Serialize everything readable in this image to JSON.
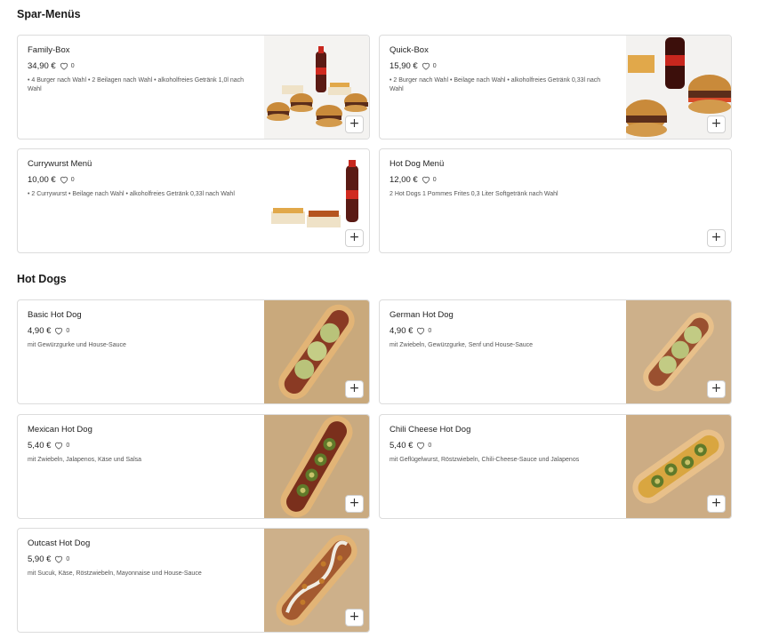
{
  "sections": [
    {
      "title": "Spar-Menüs",
      "items": [
        {
          "name": "Family-Box",
          "price": "34,90 €",
          "likes": "0",
          "desc": "• 4 Burger nach Wahl • 2 Beilagen nach Wahl • alkoholfreies Getränk 1,0l nach Wahl",
          "image": "family-box-image"
        },
        {
          "name": "Quick-Box",
          "price": "15,90 €",
          "likes": "0",
          "desc": "• 2 Burger nach Wahl • Beilage nach Wahl • alkoholfreies Getränk 0,33l nach Wahl",
          "image": "quick-box-image"
        },
        {
          "name": "Currywurst Menü",
          "price": "10,00 €",
          "likes": "0",
          "desc": "• 2 Currywurst • Beilage nach Wahl • alkoholfreies Getränk 0,33l nach Wahl",
          "image": "currywurst-menu-image"
        },
        {
          "name": "Hot Dog Menü",
          "price": "12,00 €",
          "likes": "0",
          "desc": "2 Hot Dogs 1 Pommes Frites 0,3 Liter Softgetränk nach Wahl",
          "image": null
        }
      ]
    },
    {
      "title": "Hot Dogs",
      "items": [
        {
          "name": "Basic Hot Dog",
          "price": "4,90 €",
          "likes": "0",
          "desc": "mit Gewürzgurke und House-Sauce",
          "image": "basic-hot-dog-image"
        },
        {
          "name": "German Hot Dog",
          "price": "4,90 €",
          "likes": "0",
          "desc": "mit Zwiebeln, Gewürzgurke, Senf und House-Sauce",
          "image": "german-hot-dog-image"
        },
        {
          "name": "Mexican Hot Dog",
          "price": "5,40 €",
          "likes": "0",
          "desc": "mit Zwiebeln, Jalapenos, Käse und Salsa",
          "image": "mexican-hot-dog-image"
        },
        {
          "name": "Chili Cheese Hot Dog",
          "price": "5,40 €",
          "likes": "0",
          "desc": "mit Geflügelwurst, Röstzwiebeln, Chili-Cheese-Sauce und Jalapenos",
          "image": "chili-cheese-hot-dog-image"
        },
        {
          "name": "Outcast Hot Dog",
          "price": "5,90 €",
          "likes": "0",
          "desc": "mit Sucuk, Käse, Röstzwiebeln, Mayonnaise und House-Sauce",
          "image": "outcast-hot-dog-image"
        }
      ]
    }
  ],
  "add_label": "+",
  "colors": {
    "accent": "#1a1a1a",
    "border": "#dcdcdc",
    "muted": "#555555"
  }
}
